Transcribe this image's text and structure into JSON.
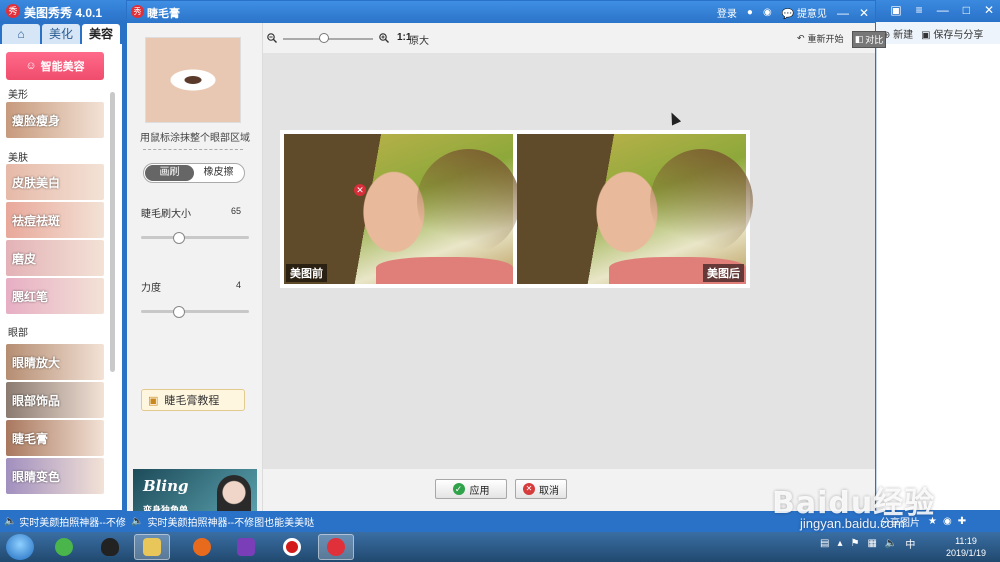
{
  "app": {
    "title": "美图秀秀 4.0.1",
    "logo_text": "秀",
    "tabs": [
      {
        "label": "⌂"
      },
      {
        "label": "美化"
      },
      {
        "label": "美容"
      }
    ],
    "smart_beauty_label": "智能美容",
    "sections": {
      "shape": "美形",
      "skin": "美肤",
      "eye": "眼部"
    },
    "items": [
      {
        "label": "瘦脸瘦身",
        "color": "#c79a7d"
      },
      {
        "label": "皮肤美白",
        "color": "#e6b9a8"
      },
      {
        "label": "祛痘祛斑",
        "color": "#e8a89a"
      },
      {
        "label": "磨皮",
        "color": "#e3b2b6"
      },
      {
        "label": "腮红笔",
        "color": "#e7aec4"
      },
      {
        "label": "眼睛放大",
        "color": "#b58d72"
      },
      {
        "label": "眼部饰品",
        "color": "#8a7a70"
      },
      {
        "label": "睫毛膏",
        "color": "#a9785e"
      },
      {
        "label": "眼睛变色",
        "color": "#a18fbf"
      }
    ],
    "status_text": "实时美颜拍照神器--不修图",
    "right_toolbar": {
      "new_label": "新建",
      "save_share_label": "保存与分享"
    },
    "share_label": "分享图片"
  },
  "dialog": {
    "title": "睫毛膏",
    "login_label": "登录",
    "feedback_label": "提意见",
    "hint": "用鼠标涂抹整个眼部区域",
    "modes": [
      {
        "label": "画刷",
        "active": true
      },
      {
        "label": "橡皮擦",
        "active": false
      }
    ],
    "brush_size": {
      "label": "睫毛刷大小",
      "value": "65",
      "level": 0.35
    },
    "strength": {
      "label": "力度",
      "value": "4",
      "level": 0.35
    },
    "tutorial_label": "睫毛膏教程",
    "ad": {
      "title": "Bling",
      "subtitle": "变身独角兽"
    },
    "toolbar": {
      "ratio": "1:1",
      "original_size": "原大",
      "restart": "重新开始",
      "compare": "对比",
      "zoom_level": 0.45
    },
    "before_label": "美图前",
    "after_label": "美图后",
    "apply_label": "应用",
    "cancel_label": "取消",
    "status_text": "实时美颜拍照神器--不修图也能美美哒"
  },
  "taskbar": {
    "clock_time": "11:19",
    "clock_date": "2019/1/19"
  },
  "watermark": {
    "logo": "Baidu经验",
    "url": "jingyan.baidu.com"
  }
}
